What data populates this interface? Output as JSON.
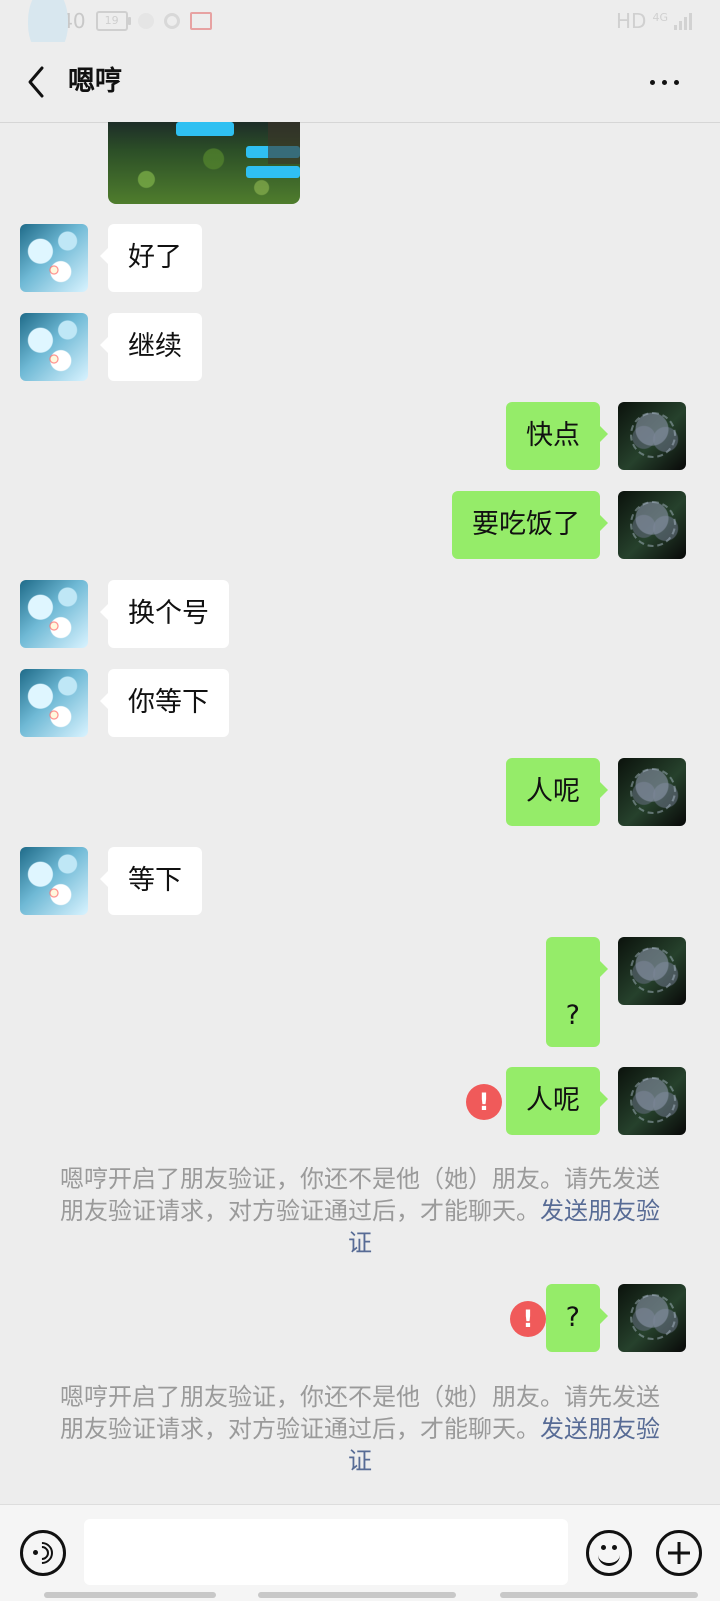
{
  "status_bar": {
    "time": "18:40",
    "battery": "19",
    "network": "HD",
    "network_type": "4G"
  },
  "chat": {
    "title": "嗯哼"
  },
  "messages": {
    "m1": "好了",
    "m2": "继续",
    "m3": "快点",
    "m4": "要吃饭了",
    "m5": "换个号",
    "m6": "你等下",
    "m7": "人呢",
    "m8": "等下",
    "m9": "?",
    "m10": "人呢",
    "m11": "?"
  },
  "system_notices": {
    "text": "嗯哼开启了朋友验证，你还不是他（她）朋友。请先发送朋友验证请求，对方验证通过后，才能聊天。",
    "link": "发送朋友验证"
  },
  "icons": {
    "back": "back-icon",
    "more": "more-icon",
    "voice": "voice-icon",
    "emoji": "emoji-icon",
    "plus": "plus-icon",
    "error": "error-icon"
  },
  "input": {
    "placeholder": ""
  }
}
